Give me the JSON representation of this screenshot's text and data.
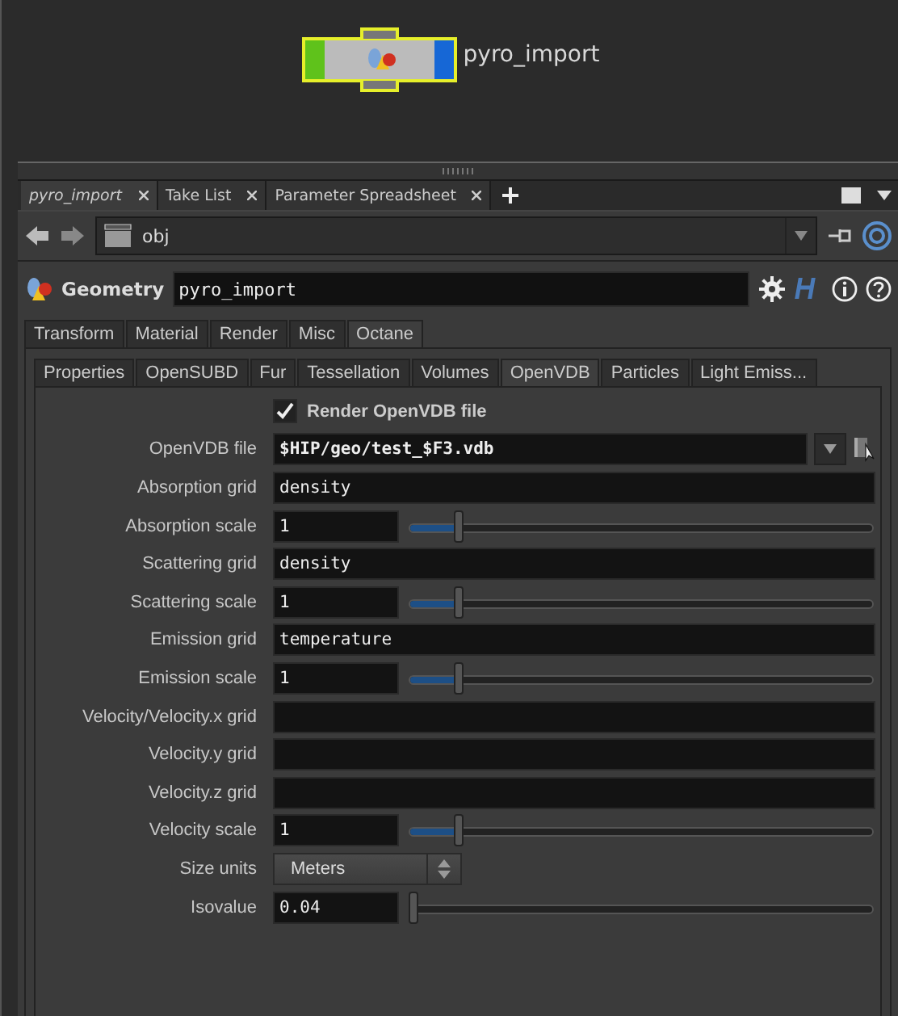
{
  "network": {
    "node": {
      "name": "pyro_import",
      "selected": true
    }
  },
  "pane_tabs": [
    {
      "label": "pyro_import",
      "selected": true
    },
    {
      "label": "Take List",
      "selected": false
    },
    {
      "label": "Parameter Spreadsheet",
      "selected": false
    }
  ],
  "path": {
    "value": "obj"
  },
  "node_header": {
    "type": "Geometry",
    "name": "pyro_import"
  },
  "tabs": [
    {
      "label": "Transform",
      "selected": false
    },
    {
      "label": "Material",
      "selected": false
    },
    {
      "label": "Render",
      "selected": false
    },
    {
      "label": "Misc",
      "selected": false
    },
    {
      "label": "Octane",
      "selected": true
    }
  ],
  "sub_tabs": [
    {
      "label": "Properties",
      "selected": false
    },
    {
      "label": "OpenSUBD",
      "selected": false
    },
    {
      "label": "Fur",
      "selected": false
    },
    {
      "label": "Tessellation",
      "selected": false
    },
    {
      "label": "Volumes",
      "selected": false
    },
    {
      "label": "OpenVDB",
      "selected": true
    },
    {
      "label": "Particles",
      "selected": false
    },
    {
      "label": "Light Emiss...",
      "selected": false
    }
  ],
  "parameters": [
    {
      "kind": "toggle",
      "label": "Render OpenVDB file",
      "checked": true
    },
    {
      "kind": "file",
      "label": "OpenVDB file",
      "value": "$HIP/geo/test_$F3.vdb"
    },
    {
      "kind": "string",
      "label": "Absorption grid",
      "value": "density"
    },
    {
      "kind": "float",
      "label": "Absorption scale",
      "value": "1",
      "level": 0.1
    },
    {
      "kind": "string",
      "label": "Scattering grid",
      "value": "density"
    },
    {
      "kind": "float",
      "label": "Scattering scale",
      "value": "1",
      "level": 0.1
    },
    {
      "kind": "string",
      "label": "Emission grid",
      "value": "temperature"
    },
    {
      "kind": "float",
      "label": "Emission scale",
      "value": "1",
      "level": 0.1
    },
    {
      "kind": "string",
      "label": "Velocity/Velocity.x grid"
    },
    {
      "kind": "string",
      "label": "Velocity.y grid"
    },
    {
      "kind": "string",
      "label": "Velocity.z grid"
    },
    {
      "kind": "float",
      "label": "Velocity scale",
      "value": "1",
      "level": 0.1
    },
    {
      "kind": "menu",
      "label": "Size units",
      "value": "Meters"
    },
    {
      "kind": "float",
      "label": "Isovalue",
      "value": "0.04",
      "level": 0
    }
  ]
}
